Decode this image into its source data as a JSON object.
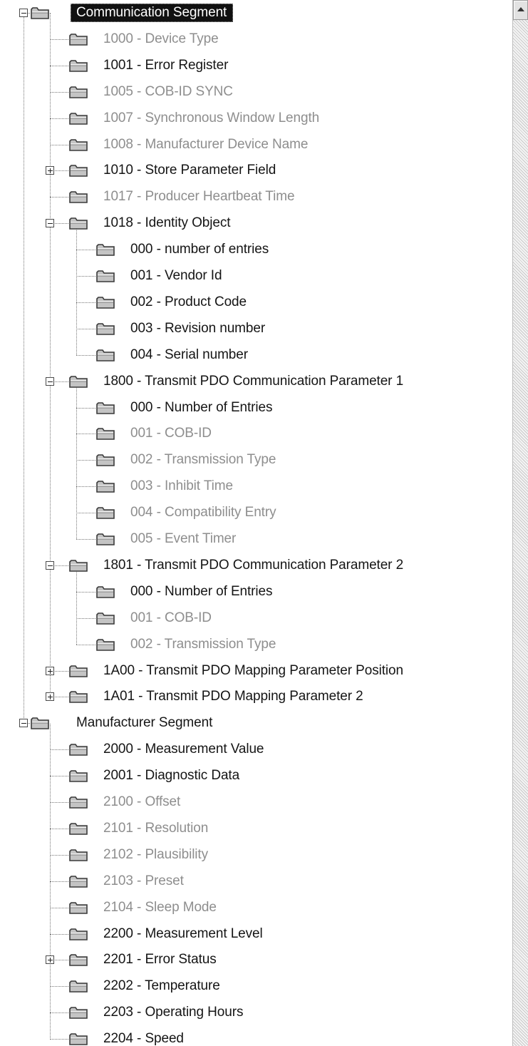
{
  "tree": [
    {
      "label": "Communication Segment",
      "level": 0,
      "toggle": "minus",
      "state": "selected",
      "root": true
    },
    {
      "label": "1000 - Device Type",
      "level": 1,
      "state": "inactive"
    },
    {
      "label": "1001 - Error Register",
      "level": 1,
      "state": "active"
    },
    {
      "label": "1005 - COB-ID SYNC",
      "level": 1,
      "state": "inactive"
    },
    {
      "label": "1007 - Synchronous Window Length",
      "level": 1,
      "state": "inactive"
    },
    {
      "label": "1008 - Manufacturer Device Name",
      "level": 1,
      "state": "inactive"
    },
    {
      "label": "1010 - Store Parameter Field",
      "level": 1,
      "toggle": "plus",
      "state": "active"
    },
    {
      "label": "1017 - Producer Heartbeat Time",
      "level": 1,
      "state": "inactive"
    },
    {
      "label": "1018 - Identity Object",
      "level": 1,
      "toggle": "minus",
      "state": "active"
    },
    {
      "label": "000 - number of entries",
      "level": 2,
      "state": "active"
    },
    {
      "label": "001 - Vendor Id",
      "level": 2,
      "state": "active"
    },
    {
      "label": "002 - Product Code",
      "level": 2,
      "state": "active"
    },
    {
      "label": "003 - Revision number",
      "level": 2,
      "state": "active"
    },
    {
      "label": "004 - Serial number",
      "level": 2,
      "state": "active"
    },
    {
      "label": "1800 - Transmit PDO Communication Parameter 1",
      "level": 1,
      "toggle": "minus",
      "state": "active"
    },
    {
      "label": "000 - Number of Entries",
      "level": 2,
      "state": "active"
    },
    {
      "label": "001 - COB-ID",
      "level": 2,
      "state": "inactive"
    },
    {
      "label": "002 - Transmission Type",
      "level": 2,
      "state": "inactive"
    },
    {
      "label": "003 - Inhibit Time",
      "level": 2,
      "state": "inactive"
    },
    {
      "label": "004 - Compatibility Entry",
      "level": 2,
      "state": "inactive"
    },
    {
      "label": "005 - Event Timer",
      "level": 2,
      "state": "inactive"
    },
    {
      "label": "1801 - Transmit PDO Communication Parameter 2",
      "level": 1,
      "toggle": "minus",
      "state": "active"
    },
    {
      "label": "000 - Number of Entries",
      "level": 2,
      "state": "active"
    },
    {
      "label": "001 - COB-ID",
      "level": 2,
      "state": "inactive"
    },
    {
      "label": "002 - Transmission Type",
      "level": 2,
      "state": "inactive"
    },
    {
      "label": "1A00 - Transmit PDO Mapping Parameter Position",
      "level": 1,
      "toggle": "plus",
      "state": "active"
    },
    {
      "label": "1A01 - Transmit PDO Mapping Parameter 2",
      "level": 1,
      "toggle": "plus",
      "state": "active"
    },
    {
      "label": "Manufacturer Segment",
      "level": 0,
      "toggle": "minus",
      "state": "active"
    },
    {
      "label": "2000 - Measurement Value",
      "level": 1,
      "state": "active"
    },
    {
      "label": "2001 - Diagnostic Data",
      "level": 1,
      "state": "active"
    },
    {
      "label": "2100 - Offset",
      "level": 1,
      "state": "inactive"
    },
    {
      "label": "2101 - Resolution",
      "level": 1,
      "state": "inactive"
    },
    {
      "label": "2102 - Plausibility",
      "level": 1,
      "state": "inactive"
    },
    {
      "label": "2103 - Preset",
      "level": 1,
      "state": "inactive"
    },
    {
      "label": "2104 - Sleep Mode",
      "level": 1,
      "state": "inactive"
    },
    {
      "label": "2200 - Measurement Level",
      "level": 1,
      "state": "active"
    },
    {
      "label": "2201 - Error Status",
      "level": 1,
      "toggle": "plus",
      "state": "active"
    },
    {
      "label": "2202 - Temperature",
      "level": 1,
      "state": "active"
    },
    {
      "label": "2203 - Operating Hours",
      "level": 1,
      "state": "active"
    },
    {
      "label": "2204 - Speed",
      "level": 1,
      "state": "active"
    }
  ],
  "colors": {
    "selected_bg": "#111111",
    "selected_text": "#ffffff",
    "active_text": "#151515",
    "inactive_text": "#8e8e8e",
    "folder_fill": "#c4c4c4",
    "folder_stroke": "#3a3a3a"
  },
  "icons": {
    "folder": "folder-icon",
    "expand": "plus-box-icon",
    "collapse": "minus-box-icon",
    "scroll_up": "arrow-up-icon"
  }
}
